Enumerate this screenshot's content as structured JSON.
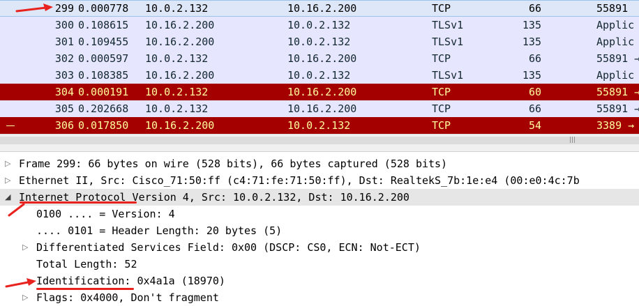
{
  "packet_list": {
    "rows": [
      {
        "no": "299",
        "time": "0.000778",
        "src": "10.0.2.132",
        "dst": "10.16.2.200",
        "proto": "TCP",
        "len": "66",
        "info": "55891"
      },
      {
        "no": "300",
        "time": "0.108615",
        "src": "10.16.2.200",
        "dst": "10.0.2.132",
        "proto": "TLSv1",
        "len": "135",
        "info": "Applic"
      },
      {
        "no": "301",
        "time": "0.109455",
        "src": "10.16.2.200",
        "dst": "10.0.2.132",
        "proto": "TLSv1",
        "len": "135",
        "info": "Applic"
      },
      {
        "no": "302",
        "time": "0.000597",
        "src": "10.0.2.132",
        "dst": "10.16.2.200",
        "proto": "TCP",
        "len": "66",
        "info": "55891 →"
      },
      {
        "no": "303",
        "time": "0.108385",
        "src": "10.16.2.200",
        "dst": "10.0.2.132",
        "proto": "TLSv1",
        "len": "135",
        "info": "Applic"
      },
      {
        "no": "304",
        "time": "0.000191",
        "src": "10.0.2.132",
        "dst": "10.16.2.200",
        "proto": "TCP",
        "len": "60",
        "info": "55891 →"
      },
      {
        "no": "305",
        "time": "0.202668",
        "src": "10.0.2.132",
        "dst": "10.16.2.200",
        "proto": "TCP",
        "len": "66",
        "info": "55891 →"
      },
      {
        "no": "306",
        "time": "0.017850",
        "src": "10.16.2.200",
        "dst": "10.0.2.132",
        "proto": "TCP",
        "len": "54",
        "info": "3389 →"
      }
    ]
  },
  "details": {
    "frame": "Frame 299: 66 bytes on wire (528 bits), 66 bytes captured (528 bits)",
    "ethernet": "Ethernet II, Src: Cisco_71:50:ff (c4:71:fe:71:50:ff), Dst: RealtekS_7b:1e:e4 (00:e0:4c:7b",
    "ip": "Internet Protocol Version 4, Src: 10.0.2.132, Dst: 10.16.2.200",
    "version": "0100 .... = Version: 4",
    "header_length": ".... 0101 = Header Length: 20 bytes (5)",
    "dsf": "Differentiated Services Field: 0x00 (DSCP: CS0, ECN: Not-ECT)",
    "total_length": "Total Length: 52",
    "identification": "Identification: 0x4a1a (18970)",
    "flags": "Flags: 0x4000, Don't fragment"
  },
  "icons": {
    "expand": "triangle-right-icon",
    "collapse": "triangle-down-icon",
    "annotation": "red-arrow-icon"
  },
  "colors": {
    "row_normal_bg": "#e7e6ff",
    "row_warn_bg": "#a40000",
    "row_warn_fg": "#fffc9c",
    "annotation": "#e8231f"
  }
}
